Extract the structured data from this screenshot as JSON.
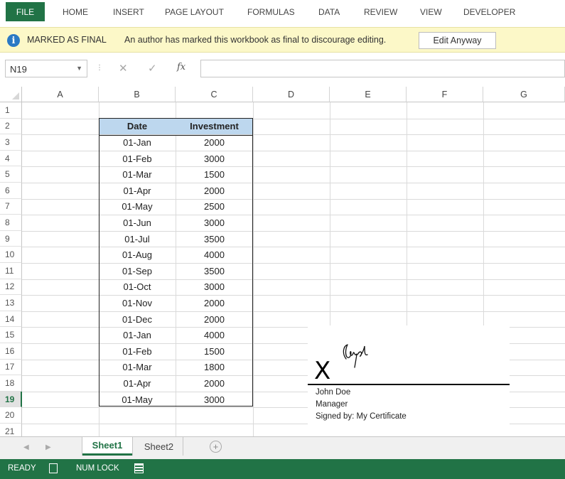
{
  "ribbon": {
    "tabs": [
      "FILE",
      "HOME",
      "INSERT",
      "PAGE LAYOUT",
      "FORMULAS",
      "DATA",
      "REVIEW",
      "VIEW",
      "DEVELOPER"
    ]
  },
  "message_bar": {
    "title": "MARKED AS FINAL",
    "text": "An author has marked this workbook as final to discourage editing.",
    "button": "Edit Anyway",
    "icon": "info-icon"
  },
  "formula_bar": {
    "name_box": "N19",
    "fx_symbol": "fx",
    "content": ""
  },
  "grid": {
    "columns": [
      "A",
      "B",
      "C",
      "D",
      "E",
      "F",
      "G"
    ],
    "rows": [
      "1",
      "2",
      "3",
      "4",
      "5",
      "6",
      "7",
      "8",
      "9",
      "10",
      "11",
      "12",
      "13",
      "14",
      "15",
      "16",
      "17",
      "18",
      "19",
      "20",
      "21"
    ],
    "active_row": "19"
  },
  "table": {
    "headers": [
      "Date",
      "Investment"
    ],
    "rows": [
      [
        "01-Jan",
        "2000"
      ],
      [
        "01-Feb",
        "3000"
      ],
      [
        "01-Mar",
        "1500"
      ],
      [
        "01-Apr",
        "2000"
      ],
      [
        "01-May",
        "2500"
      ],
      [
        "01-Jun",
        "3000"
      ],
      [
        "01-Jul",
        "3500"
      ],
      [
        "01-Aug",
        "4000"
      ],
      [
        "01-Sep",
        "3500"
      ],
      [
        "01-Oct",
        "3000"
      ],
      [
        "01-Nov",
        "2000"
      ],
      [
        "01-Dec",
        "2000"
      ],
      [
        "01-Jan",
        "4000"
      ],
      [
        "01-Feb",
        "1500"
      ],
      [
        "01-Mar",
        "1800"
      ],
      [
        "01-Apr",
        "2000"
      ],
      [
        "01-May",
        "3000"
      ]
    ]
  },
  "signature": {
    "mark": "X",
    "name": "John Doe",
    "title": "Manager",
    "signed_by": "Signed by: My Certificate"
  },
  "sheets": {
    "tabs": [
      "Sheet1",
      "Sheet2"
    ],
    "active": "Sheet1"
  },
  "status_bar": {
    "ready": "READY",
    "num_lock": "NUM LOCK",
    "color": "#217346"
  }
}
